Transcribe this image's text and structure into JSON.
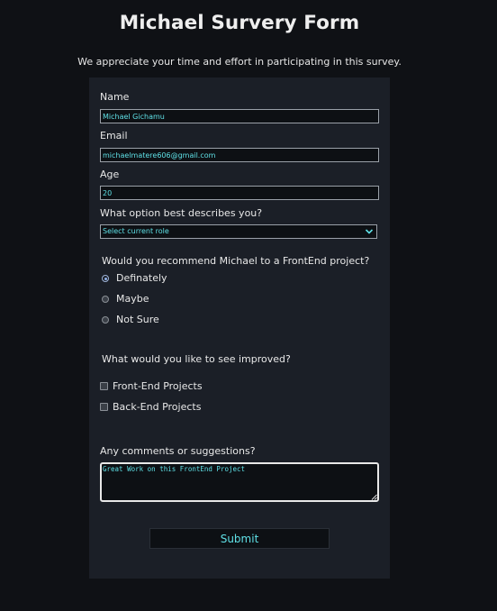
{
  "header": {
    "title": "Michael Survery Form",
    "subtitle": "We appreciate your time and effort in participating in this survey."
  },
  "form": {
    "name_label": "Name",
    "name_value": "Michael Gichamu",
    "email_label": "Email",
    "email_value": "michaelmatere606@gmail.com",
    "age_label": "Age",
    "age_value": "20",
    "role_label": "What option best describes you?",
    "role_selected": "Select current role",
    "recommend_label": "Would you recommend Michael to a FrontEnd project?",
    "recommend_options": [
      {
        "label": "Definately",
        "checked": true
      },
      {
        "label": "Maybe",
        "checked": false
      },
      {
        "label": "Not Sure",
        "checked": false
      }
    ],
    "improve_label": "What would you like to see improved?",
    "improve_options": [
      {
        "label": "Front-End Projects",
        "checked": false
      },
      {
        "label": "Back-End Projects",
        "checked": false
      }
    ],
    "comments_label": "Any comments or suggestions?",
    "comments_value": "Great Work on this FrontEnd Project",
    "submit_label": "Submit"
  },
  "colors": {
    "page_background": "#0f1115",
    "form_background": "#1b1f27",
    "input_text": "#5fe0e6",
    "label_text": "#e8e8e8"
  },
  "icons": {
    "select_arrow": "chevron-down-icon",
    "textarea_resize": "resize-grip-icon"
  }
}
